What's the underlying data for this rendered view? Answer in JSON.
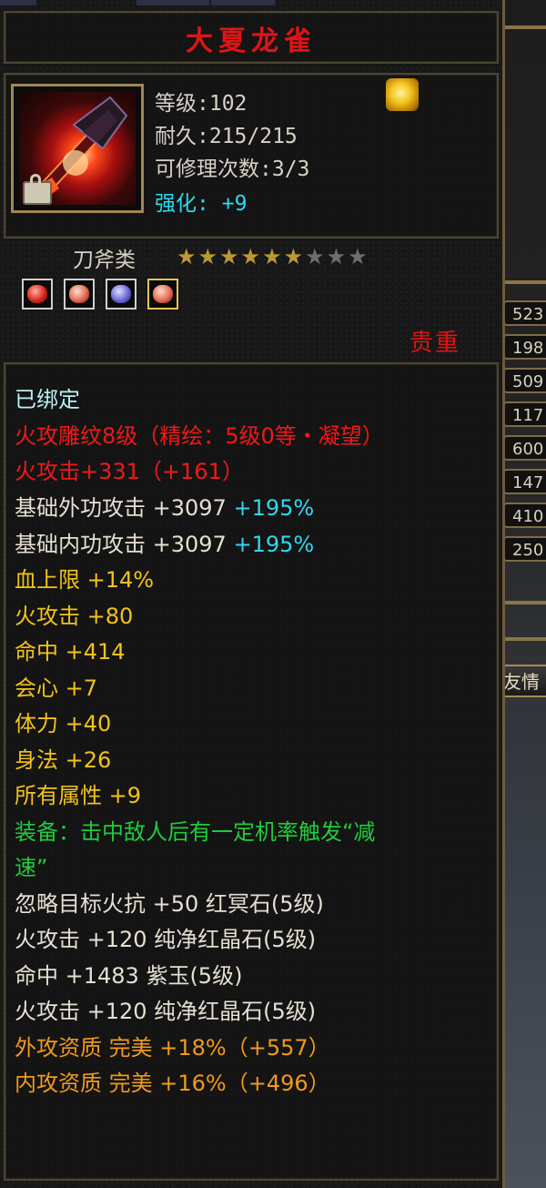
{
  "item": {
    "name": "大夏龙雀",
    "level": "等级:102",
    "durability": "耐久:215/215",
    "repair": "可修理次数:3/3",
    "enhance_label": "强化:",
    "enhance_value": "+9",
    "category": "刀斧类",
    "stars_total": 9,
    "stars_filled": 6,
    "rarity": "贵重",
    "icon": "sword-icon",
    "badge_icon": "gold-talisman-icon",
    "gems": [
      {
        "icon": "red-gem-icon",
        "color": "#d8281c"
      },
      {
        "icon": "red-crystal-icon",
        "color": "#e56a55"
      },
      {
        "icon": "purple-jade-icon",
        "color": "#6a6ad8"
      },
      {
        "icon": "red-crystal-icon",
        "color": "#e56a55"
      }
    ]
  },
  "attributes": {
    "bound": "已绑定",
    "engrave": "火攻雕纹8级（精绘：5级0等・凝望）",
    "fire_attack_main": "火攻击+331（+161）",
    "base_ext_label": "基础外功攻击 +3097 ",
    "base_ext_pct": "+195%",
    "base_int_label": "基础内功攻击 +3097 ",
    "base_int_pct": "+195%",
    "yellow_stats": [
      "血上限 +14%",
      "火攻击 +80",
      "命中 +414",
      "会心 +7",
      "体力 +40",
      "身法 +26",
      "所有属性 +9"
    ],
    "equip_effect_1": "装备：击中敌人后有一定机率触发“减",
    "equip_effect_2": "速”",
    "gem_stats": [
      "忽略目标火抗 +50 红冥石(5级)",
      "火攻击 +120 纯净红晶石(5级)",
      "命中 +1483 紫玉(5级)",
      "火攻击 +120 纯净红晶石(5级)"
    ],
    "quality_ext": "外攻资质  完美 +18%（+557）",
    "quality_int": "内攻资质  完美 +16%（+496）"
  },
  "side_panel": {
    "values": [
      "523",
      "198",
      "509",
      "117",
      "600",
      "147",
      "410",
      "250"
    ],
    "tab_label": "友情"
  }
}
